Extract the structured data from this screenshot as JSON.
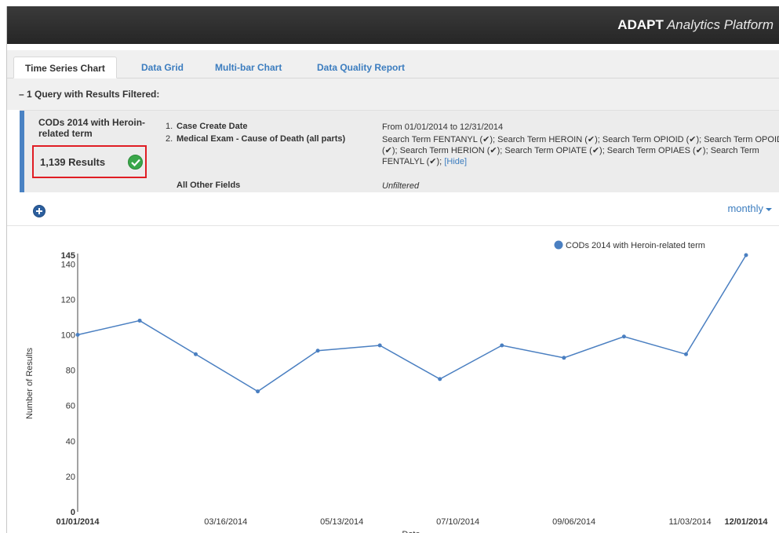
{
  "app": {
    "brand_bold": "ADAPT",
    "brand_italic": " Analytics Platform"
  },
  "tabs": [
    {
      "label": "Time Series Chart",
      "active": true
    },
    {
      "label": "Data Grid",
      "active": false
    },
    {
      "label": "Multi-bar Chart",
      "active": false
    },
    {
      "label": "Data Quality Report",
      "active": false
    }
  ],
  "query_header": "– 1 Query with Results Filtered:",
  "query": {
    "name": "CODs 2014 with Heroin-related term",
    "results": "1,139 Results",
    "accent_color": "#4a82c3",
    "filters": [
      {
        "num": "1.",
        "label": "Case Create Date",
        "value": "From 01/01/2014 to 12/31/2014"
      },
      {
        "num": "2.",
        "label": "Medical Exam - Cause of Death (all parts)",
        "value": "Search Term FENTANYL (✔); Search Term HEROIN (✔); Search Term OPIOID (✔); Search Term OPOID (✔); Search Term HERION (✔); Search Term OPIATE (✔); Search Term OPIAES (✔); Search Term FENTALYL (✔);",
        "link": "[Hide]"
      },
      {
        "num": "",
        "label": "All Other Fields",
        "value": "Unfiltered"
      }
    ]
  },
  "toolbar": {
    "add_icon": "plus-circle-icon",
    "period": "monthly"
  },
  "chart_data": {
    "type": "line",
    "series": [
      {
        "name": "CODs 2014 with Heroin-related term",
        "color": "#4a7fc1",
        "x": [
          "2014-01-01",
          "2014-02-01",
          "2014-03-01",
          "2014-04-01",
          "2014-05-01",
          "2014-06-01",
          "2014-07-01",
          "2014-08-01",
          "2014-09-01",
          "2014-10-01",
          "2014-11-01",
          "2014-12-01"
        ],
        "values": [
          100,
          108,
          89,
          68,
          91,
          94,
          75,
          94,
          87,
          99,
          89,
          145
        ]
      }
    ],
    "xlabel": "Date",
    "ylabel": "Number of Results",
    "ylim": [
      0,
      145
    ],
    "y_ticks": [
      0,
      20,
      40,
      60,
      80,
      100,
      120,
      140,
      145
    ],
    "x_ticks": [
      "01/01/2014",
      "03/16/2014",
      "05/13/2014",
      "07/10/2014",
      "09/06/2014",
      "11/03/2014",
      "12/01/2014"
    ],
    "legend_position": "top-right"
  }
}
